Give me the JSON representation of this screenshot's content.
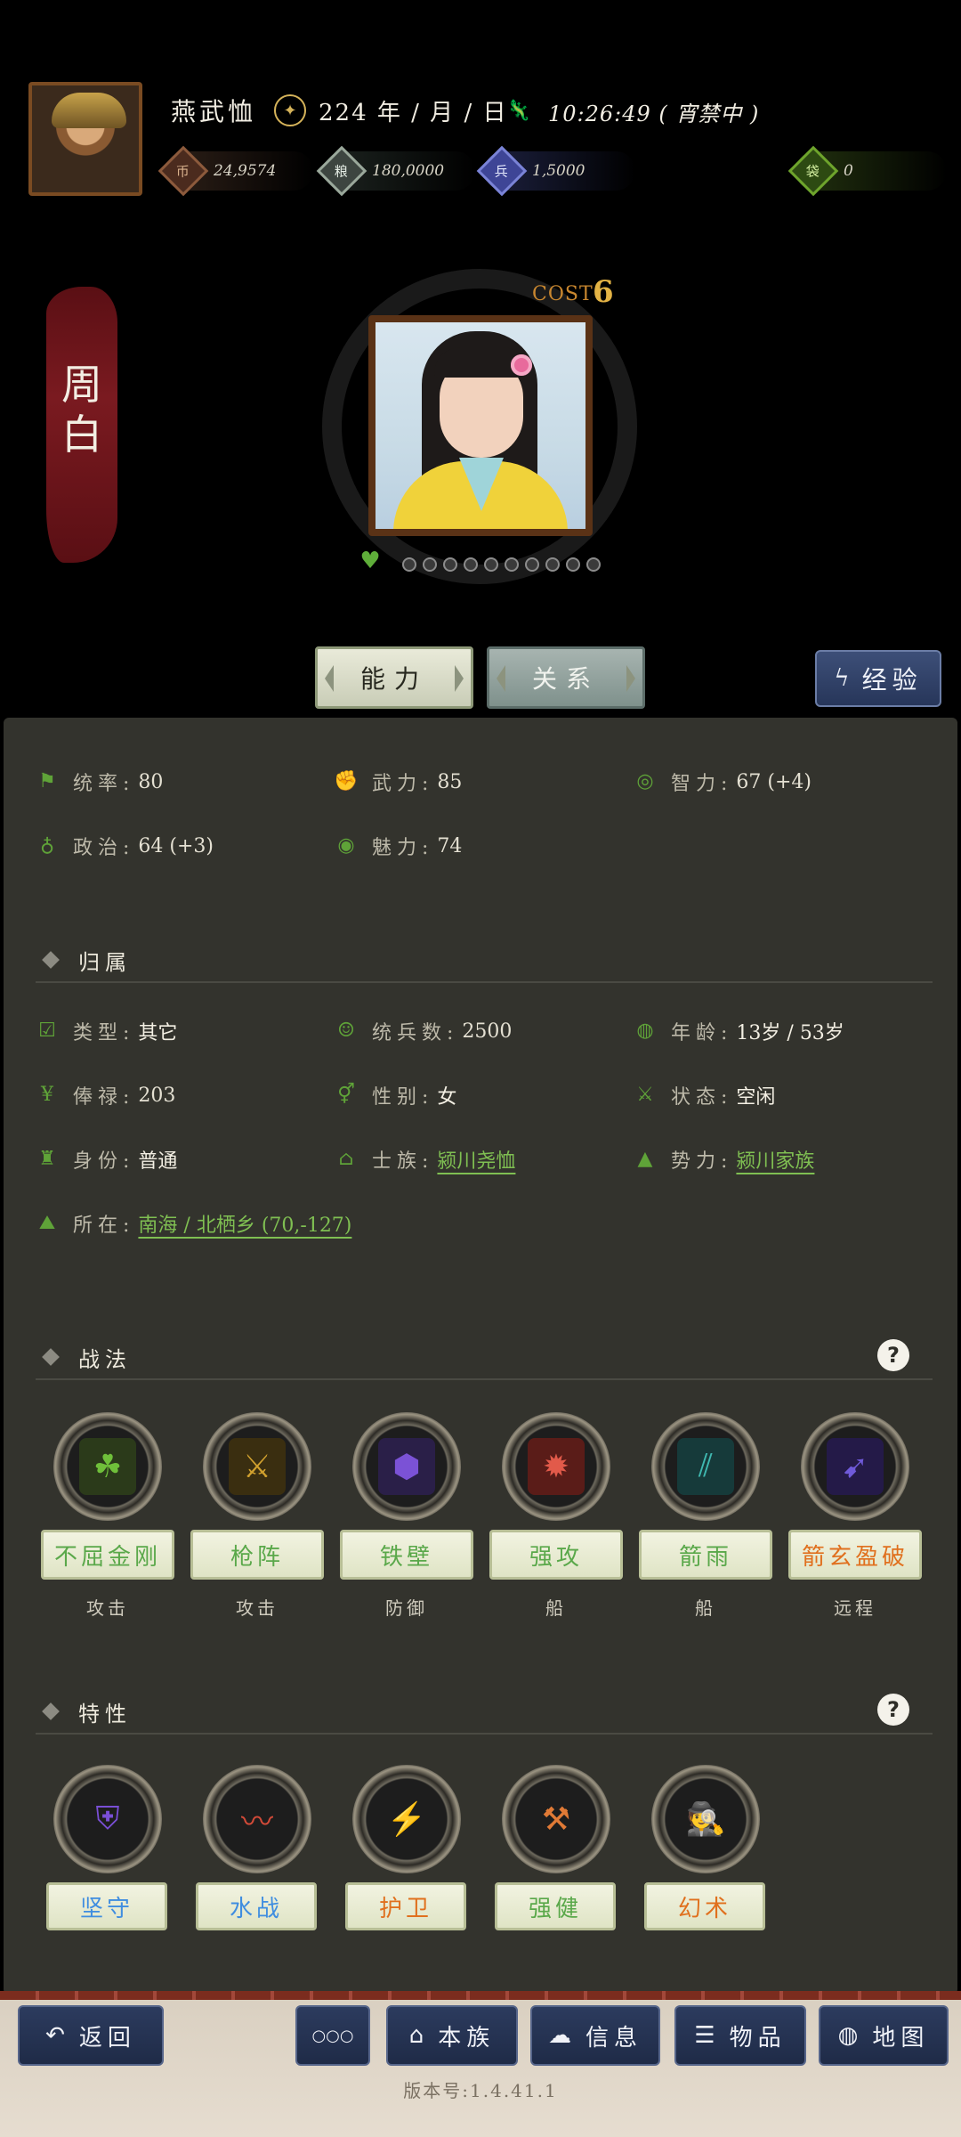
{
  "header": {
    "player_name": "燕武恤",
    "date": "224 年 / 月 / 日",
    "time": "10:26:49 ( 宵禁中 )",
    "resources": {
      "gold": "24,9574",
      "food": "180,0000",
      "troops": "1,5000",
      "extra": "0"
    }
  },
  "hero": {
    "name": "周白",
    "cost_label": "COST",
    "cost": "6",
    "loyalty_dots": 10
  },
  "tabs": {
    "ability": "能力",
    "relation": "关系",
    "exp": "经验"
  },
  "stats": [
    {
      "label": "统率:",
      "value": "80",
      "icon": "flag-icon"
    },
    {
      "label": "武力:",
      "value": "85",
      "icon": "fist-icon"
    },
    {
      "label": "智力:",
      "value": "67 (+4)",
      "icon": "brain-icon"
    },
    {
      "label": "政治:",
      "value": "64 (+3)",
      "icon": "bag-icon"
    },
    {
      "label": "魅力:",
      "value": "74",
      "icon": "eye-icon"
    }
  ],
  "belonging": {
    "title": "归属",
    "type_label": "类型:",
    "type_value": "其它",
    "soldiers_label": "统兵数:",
    "soldiers_value": "2500",
    "age_label": "年龄:",
    "age_value": "13岁 / 53岁",
    "salary_label": "俸禄:",
    "salary_value": "203",
    "gender_label": "性别:",
    "gender_value": "女",
    "status_label": "状态:",
    "status_value": "空闲",
    "identity_label": "身份:",
    "identity_value": "普通",
    "clan_label": "士族:",
    "clan_value": "颍川尧恤",
    "power_label": "势力:",
    "power_value": "颍川家族",
    "location_label": "所在:",
    "location_value": "南海 / 北栖乡 (70,-127)"
  },
  "tactics": {
    "title": "战法",
    "items": [
      {
        "name": "不屈金刚",
        "tag": "攻击",
        "color": "#5aa84a",
        "icon": "claw-icon"
      },
      {
        "name": "枪阵",
        "tag": "攻击",
        "color": "#5aa84a",
        "icon": "spear-shield-icon"
      },
      {
        "name": "铁壁",
        "tag": "防御",
        "color": "#5aa84a",
        "icon": "grid-shield-icon"
      },
      {
        "name": "强攻",
        "tag": "船",
        "color": "#5aa84a",
        "icon": "shatter-icon"
      },
      {
        "name": "箭雨",
        "tag": "船",
        "color": "#5aa84a",
        "icon": "arrow-rain-icon"
      },
      {
        "name": "箭玄盈破",
        "tag": "远程",
        "color": "#e0701e",
        "icon": "arrow-pierce-icon"
      }
    ]
  },
  "traits": {
    "title": "特性",
    "items": [
      {
        "name": "坚守",
        "color": "#3f8de0",
        "icon": "shields-icon"
      },
      {
        "name": "水战",
        "color": "#3f8de0",
        "icon": "wave-icon"
      },
      {
        "name": "护卫",
        "color": "#e0701e",
        "icon": "guard-shield-icon"
      },
      {
        "name": "强健",
        "color": "#5aa84a",
        "icon": "strongman-icon"
      },
      {
        "name": "幻术",
        "color": "#e0701e",
        "icon": "spy-icon"
      }
    ]
  },
  "nav": {
    "back": "返回",
    "more": "○○○",
    "clan": "本族",
    "info": "信息",
    "items": "物品",
    "map": "地图"
  },
  "version": "版本号:1.4.41.1"
}
